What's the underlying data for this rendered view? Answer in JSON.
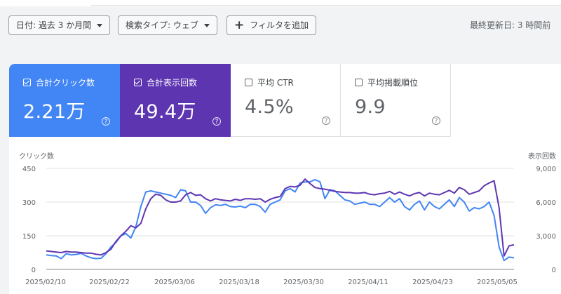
{
  "filters": {
    "date": "日付: 過去 3 か月間",
    "search_type": "検索タイプ: ウェブ",
    "add_filter": "フィルタを追加"
  },
  "last_updated": "最終更新日: 3 時間前",
  "metrics": [
    {
      "label": "合計クリック数",
      "value": "2.21万",
      "checked": true,
      "color": "#4285f4"
    },
    {
      "label": "合計表示回数",
      "value": "49.4万",
      "checked": true,
      "color": "#5e35b1"
    },
    {
      "label": "平均 CTR",
      "value": "4.5%",
      "checked": false
    },
    {
      "label": "平均掲載順位",
      "value": "9.9",
      "checked": false
    }
  ],
  "help_glyph": "?",
  "chart_data": {
    "type": "line",
    "y_left_label": "クリック数",
    "y_right_label": "表示回数",
    "y_left_ticks": [
      "0",
      "150",
      "300",
      "450"
    ],
    "y_right_ticks": [
      "0",
      "3,000",
      "6,000",
      "9,000"
    ],
    "ylim_left": [
      0,
      450
    ],
    "ylim_right": [
      0,
      9000
    ],
    "x_ticks": [
      "2025/02/10",
      "2025/02/22",
      "2025/03/06",
      "2025/03/18",
      "2025/03/30",
      "2025/04/11",
      "2025/04/23",
      "2025/05/05"
    ],
    "series": [
      {
        "axis": "left",
        "color": "#4285f4",
        "values": [
          65,
          62,
          60,
          48,
          70,
          65,
          67,
          72,
          60,
          52,
          48,
          50,
          70,
          100,
          120,
          150,
          160,
          140,
          190,
          280,
          345,
          350,
          345,
          340,
          335,
          330,
          320,
          355,
          350,
          300,
          300,
          285,
          250,
          275,
          288,
          285,
          290,
          280,
          278,
          282,
          275,
          290,
          290,
          280,
          255,
          290,
          300,
          310,
          350,
          360,
          345,
          385,
          390,
          390,
          400,
          390,
          315,
          355,
          350,
          330,
          310,
          305,
          290,
          295,
          300,
          290,
          290,
          280,
          300,
          320,
          300,
          315,
          280,
          265,
          290,
          305,
          265,
          300,
          280,
          270,
          290,
          310,
          280,
          320,
          300,
          260,
          275,
          270,
          280,
          300,
          240,
          100,
          40,
          55,
          52
        ]
      },
      {
        "axis": "right",
        "color": "#5e35b1",
        "values": [
          1650,
          1600,
          1550,
          1500,
          1600,
          1550,
          1550,
          1500,
          1450,
          1450,
          1350,
          1300,
          1500,
          1800,
          2500,
          3000,
          3400,
          3900,
          3700,
          4100,
          5400,
          6300,
          6700,
          6600,
          6200,
          6000,
          6000,
          6100,
          6650,
          6850,
          6600,
          6650,
          6300,
          6100,
          6300,
          6200,
          6150,
          6100,
          6250,
          6150,
          6300,
          6300,
          6250,
          6300,
          6000,
          6250,
          6400,
          6500,
          7200,
          7400,
          7350,
          7500,
          8050,
          7650,
          7300,
          7200,
          7150,
          7050,
          6950,
          6900,
          6850,
          6850,
          6800,
          6800,
          6850,
          6700,
          6650,
          6750,
          6800,
          6950,
          6700,
          6900,
          6700,
          6550,
          6750,
          6850,
          6550,
          6800,
          6700,
          6650,
          6850,
          7050,
          6800,
          7300,
          7100,
          6700,
          6850,
          7000,
          7450,
          7700,
          7900,
          5500,
          1200,
          2100,
          2200
        ]
      }
    ]
  }
}
